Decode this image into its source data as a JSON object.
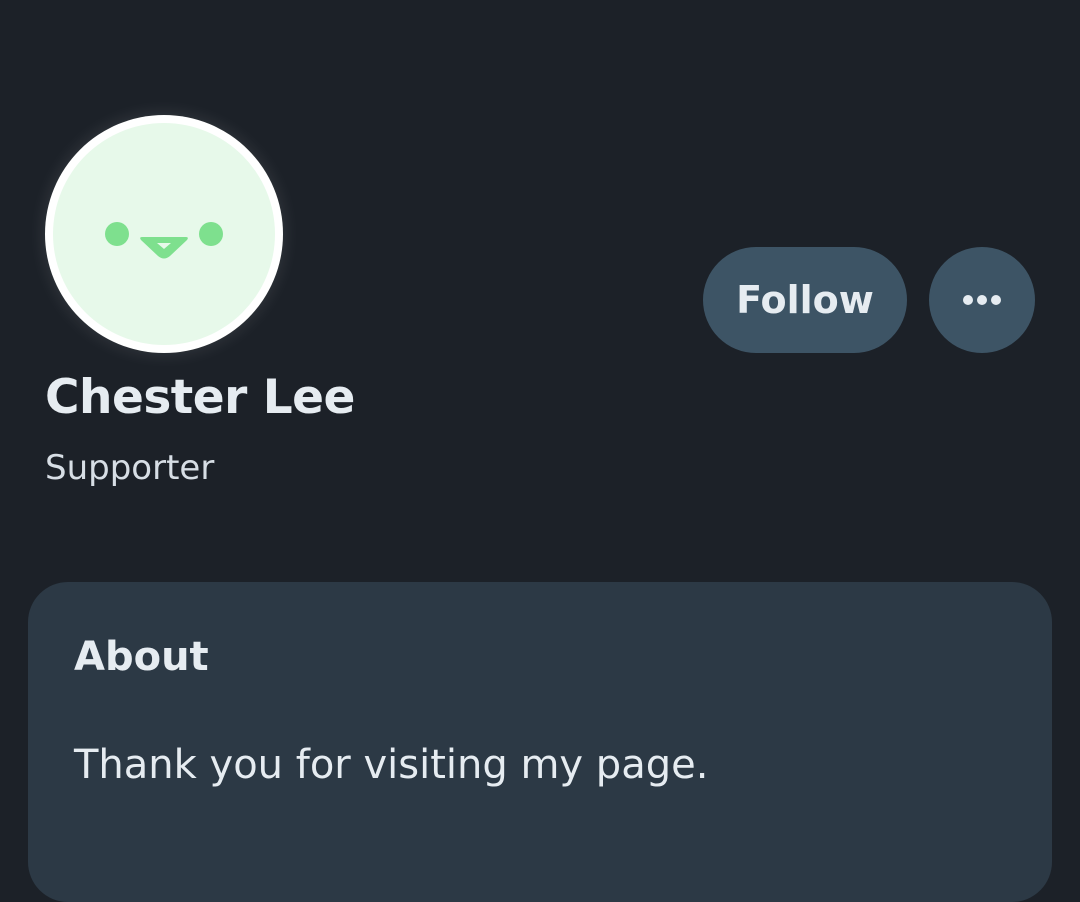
{
  "profile": {
    "name": "Chester Lee",
    "role": "Supporter"
  },
  "actions": {
    "follow_label": "Follow",
    "more_icon": "more-horizontal-icon"
  },
  "about": {
    "title": "About",
    "text": "Thank you for visiting my page."
  },
  "colors": {
    "background": "#1c2128",
    "card": "#2c3945",
    "button": "#3d5465",
    "avatar_bg": "#e7f9ea",
    "avatar_face": "#7ee08e",
    "text": "#e6ecf1"
  }
}
